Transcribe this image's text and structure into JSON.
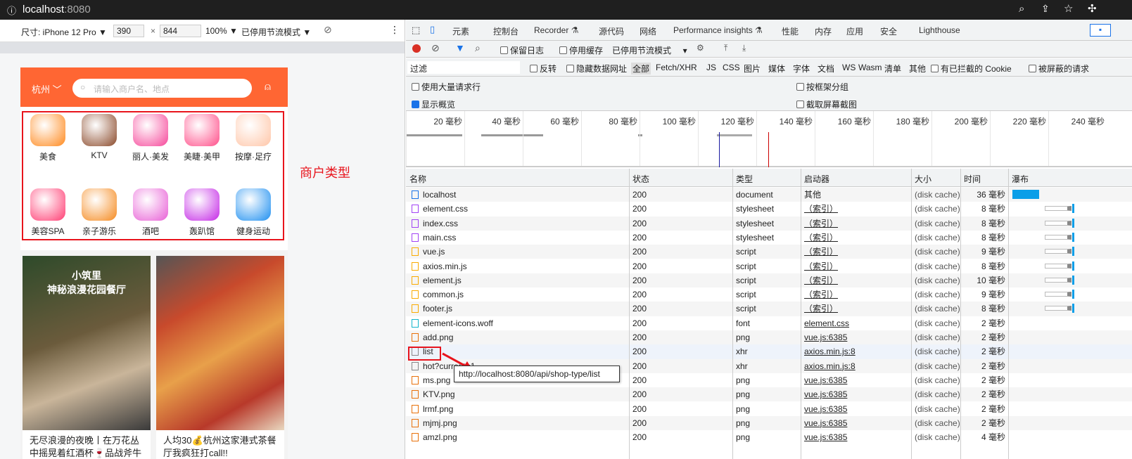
{
  "browser": {
    "host": "localhost",
    "port": ":8080"
  },
  "device_toolbar": {
    "size_label": "尺寸: iPhone 12 Pro ▼",
    "width": "390",
    "height": "844",
    "x": "×",
    "zoom": "100% ▼",
    "throttle": "已停用节流模式 ▼"
  },
  "phone": {
    "city": "杭州",
    "search_placeholder": "请输入商户名、地点",
    "categories": [
      {
        "name": "美食",
        "color": "#ff8a1f"
      },
      {
        "name": "KTV",
        "color": "#8b4a2b"
      },
      {
        "name": "丽人·美发",
        "color": "#f6479a"
      },
      {
        "name": "美睫·美甲",
        "color": "#ff4f8a"
      },
      {
        "name": "按摩·足疗",
        "color": "#ffc6a8"
      },
      {
        "name": "美容SPA",
        "color": "#ff3d73"
      },
      {
        "name": "亲子游乐",
        "color": "#f58a1f"
      },
      {
        "name": "酒吧",
        "color": "#e85fd6"
      },
      {
        "name": "轰趴馆",
        "color": "#c428e6"
      },
      {
        "name": "健身运动",
        "color": "#1e8ff0"
      }
    ],
    "cards": [
      {
        "title": "无尽浪漫的夜晚丨在万花丛中摇晃着红酒杯🍷品战斧牛排🥩",
        "overlay": "小筑里\n神秘浪漫花园餐厅"
      },
      {
        "title": "人均30💰杭州这家港式茶餐厅我疯狂打call!!"
      }
    ]
  },
  "annotation": "商户类型",
  "devtools": {
    "tabs": [
      "元素",
      "控制台",
      "Recorder ⚗",
      "源代码",
      "网络",
      "Performance insights ⚗",
      "性能",
      "内存",
      "应用",
      "安全",
      "Lighthouse"
    ],
    "active_tab": "网络",
    "toolbar": {
      "preserve_log": "保留日志",
      "disable_cache": "停用缓存",
      "throttle": "已停用节流模式"
    },
    "filter": {
      "placeholder": "过滤",
      "invert": "反转",
      "hide_data_urls": "隐藏数据网址",
      "types": [
        "全部",
        "Fetch/XHR",
        "JS",
        "CSS",
        "图片",
        "媒体",
        "字体",
        "文档",
        "WS",
        "Wasm",
        "清单",
        "其他"
      ],
      "blocked_cookies": "有已拦截的 Cookie",
      "blocked_requests": "被屏蔽的请求"
    },
    "options": {
      "large_rows": "使用大量请求行",
      "group_by_frame": "按框架分组",
      "show_overview": "显示概览",
      "screenshots": "截取屏幕截图",
      "show_overview_checked": true
    },
    "overview_ticks": [
      "20 毫秒",
      "40 毫秒",
      "60 毫秒",
      "80 毫秒",
      "100 毫秒",
      "120 毫秒",
      "140 毫秒",
      "160 毫秒",
      "180 毫秒",
      "200 毫秒",
      "220 毫秒",
      "240 毫秒"
    ],
    "columns": [
      "名称",
      "状态",
      "类型",
      "启动器",
      "大小",
      "时间",
      "瀑布"
    ],
    "rows": [
      [
        "localhost",
        "200",
        "document",
        "其他",
        "(disk cache)",
        "36 毫秒",
        "doc"
      ],
      [
        "element.css",
        "200",
        "stylesheet",
        "（索引）",
        "(disk cache)",
        "8 毫秒",
        "css"
      ],
      [
        "index.css",
        "200",
        "stylesheet",
        "（索引）",
        "(disk cache)",
        "8 毫秒",
        "css"
      ],
      [
        "main.css",
        "200",
        "stylesheet",
        "（索引）",
        "(disk cache)",
        "8 毫秒",
        "css"
      ],
      [
        "vue.js",
        "200",
        "script",
        "（索引）",
        "(disk cache)",
        "9 毫秒",
        "js"
      ],
      [
        "axios.min.js",
        "200",
        "script",
        "（索引）",
        "(disk cache)",
        "8 毫秒",
        "js"
      ],
      [
        "element.js",
        "200",
        "script",
        "（索引）",
        "(disk cache)",
        "10 毫秒",
        "js"
      ],
      [
        "common.js",
        "200",
        "script",
        "（索引）",
        "(disk cache)",
        "9 毫秒",
        "js"
      ],
      [
        "footer.js",
        "200",
        "script",
        "（索引）",
        "(disk cache)",
        "8 毫秒",
        "js"
      ],
      [
        "element-icons.woff",
        "200",
        "font",
        "element.css",
        "(disk cache)",
        "2 毫秒",
        "font"
      ],
      [
        "add.png",
        "200",
        "png",
        "vue.js:6385",
        "(disk cache)",
        "2 毫秒",
        "img"
      ],
      [
        "list",
        "200",
        "xhr",
        "axios.min.js:8",
        "(disk cache)",
        "2 毫秒",
        "xhr"
      ],
      [
        "hot?current=1",
        "200",
        "xhr",
        "axios.min.js:8",
        "(disk cache)",
        "2 毫秒",
        "xhr"
      ],
      [
        "ms.png",
        "200",
        "png",
        "vue.js:6385",
        "(disk cache)",
        "2 毫秒",
        "img"
      ],
      [
        "KTV.png",
        "200",
        "png",
        "vue.js:6385",
        "(disk cache)",
        "2 毫秒",
        "img"
      ],
      [
        "lrmf.png",
        "200",
        "png",
        "vue.js:6385",
        "(disk cache)",
        "2 毫秒",
        "img"
      ],
      [
        "mjmj.png",
        "200",
        "png",
        "vue.js:6385",
        "(disk cache)",
        "2 毫秒",
        "img"
      ],
      [
        "amzl.png",
        "200",
        "png",
        "vue.js:6385",
        "(disk cache)",
        "4 毫秒",
        "img"
      ]
    ],
    "tooltip": "http://localhost:8080/api/shop-type/list"
  }
}
